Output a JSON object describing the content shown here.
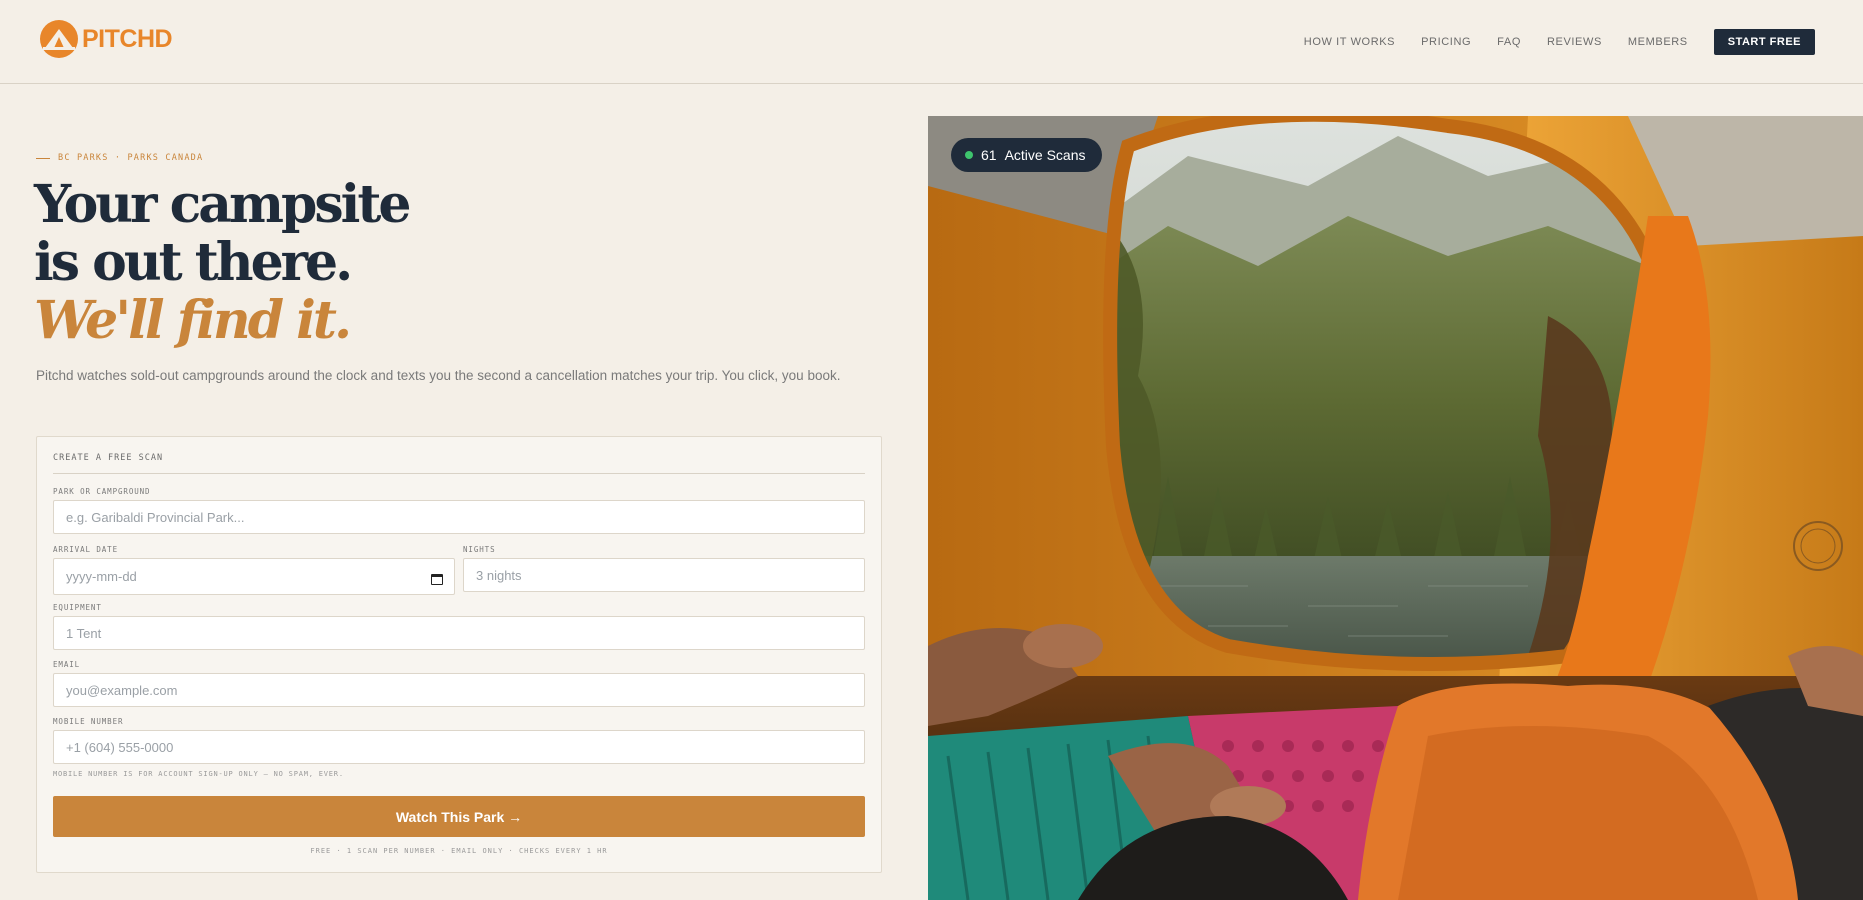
{
  "brand": {
    "name": "PITCHD"
  },
  "nav": {
    "links": [
      "HOW IT WORKS",
      "PRICING",
      "FAQ",
      "REVIEWS",
      "MEMBERS"
    ],
    "cta": "START FREE"
  },
  "hero": {
    "eyebrow": "BC PARKS · PARKS CANADA",
    "headline_line1": "Your campsite",
    "headline_line2": "is out there.",
    "headline_accent": "We'll find it.",
    "lead": "Pitchd watches sold-out campgrounds around the clock and texts you the second a cancellation matches your trip. You click, you book."
  },
  "form": {
    "title": "CREATE A FREE SCAN",
    "park": {
      "label": "PARK OR CAMPGROUND",
      "placeholder": "e.g. Garibaldi Provincial Park..."
    },
    "arrival": {
      "label": "ARRIVAL DATE",
      "placeholder": "yyyy-mm-dd"
    },
    "nights": {
      "label": "NIGHTS",
      "placeholder": "3 nights"
    },
    "equipment": {
      "label": "EQUIPMENT",
      "placeholder": "1 Tent"
    },
    "email": {
      "label": "EMAIL",
      "placeholder": "you@example.com"
    },
    "mobile": {
      "label": "MOBILE NUMBER",
      "placeholder": "+1 (604) 555-0000"
    },
    "helper": "MOBILE NUMBER IS FOR ACCOUNT SIGN-UP ONLY — NO SPAM, EVER.",
    "submit": "Watch This Park →",
    "footnote": "FREE · 1 SCAN PER NUMBER · EMAIL ONLY · CHECKS EVERY 1 HR"
  },
  "badge": {
    "count": "61",
    "label": "Active Scans"
  },
  "colors": {
    "accent": "#c9853b",
    "navy": "#1f2b3a",
    "background": "#f4efe7",
    "logo": "#e8862a",
    "live_dot": "#3ec46d"
  }
}
